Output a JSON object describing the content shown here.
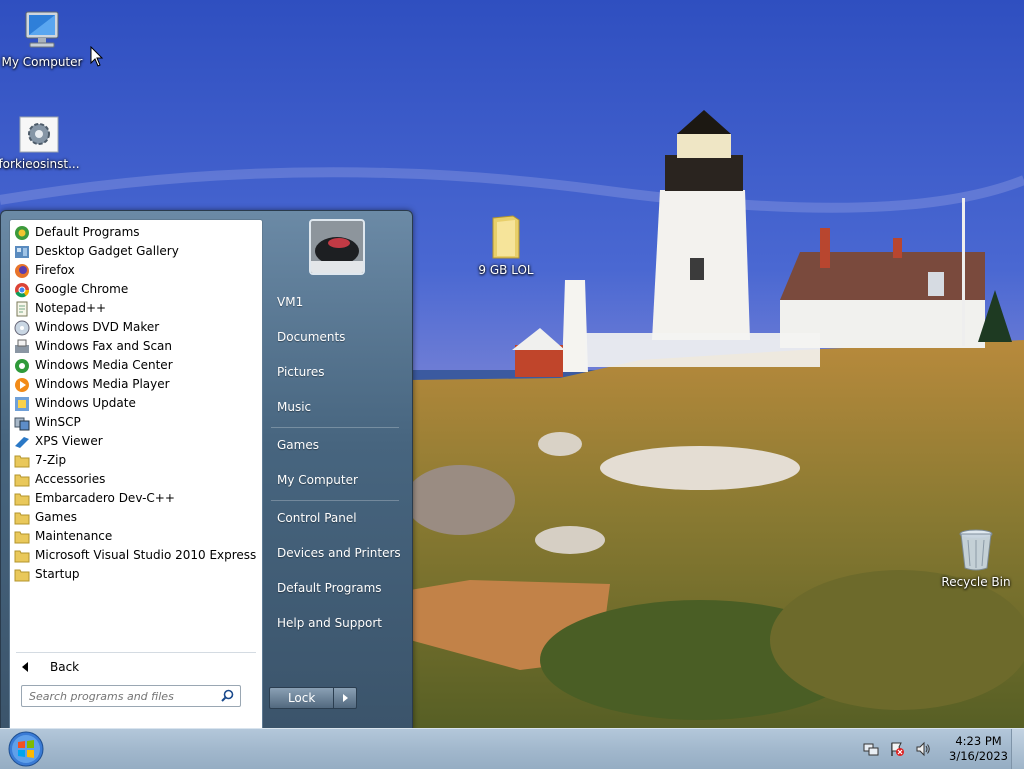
{
  "desktop": {
    "icons": [
      {
        "label": "My Computer"
      },
      {
        "label": "forkieosinst..."
      },
      {
        "label": "9 GB LOL"
      },
      {
        "label": "Recycle Bin"
      }
    ]
  },
  "start_menu": {
    "programs": [
      {
        "label": "Default Programs",
        "icon": "default-programs-icon"
      },
      {
        "label": "Desktop Gadget Gallery",
        "icon": "gadget-gallery-icon"
      },
      {
        "label": "Firefox",
        "icon": "firefox-icon"
      },
      {
        "label": "Google Chrome",
        "icon": "chrome-icon"
      },
      {
        "label": "Notepad++",
        "icon": "notepad-icon"
      },
      {
        "label": "Windows DVD Maker",
        "icon": "dvd-maker-icon"
      },
      {
        "label": "Windows Fax and Scan",
        "icon": "fax-scan-icon"
      },
      {
        "label": "Windows Media Center",
        "icon": "media-center-icon"
      },
      {
        "label": "Windows Media Player",
        "icon": "media-player-icon"
      },
      {
        "label": "Windows Update",
        "icon": "windows-update-icon"
      },
      {
        "label": "WinSCP",
        "icon": "winscp-icon"
      },
      {
        "label": "XPS Viewer",
        "icon": "xps-viewer-icon"
      },
      {
        "label": "7-Zip",
        "icon": "folder-icon"
      },
      {
        "label": "Accessories",
        "icon": "folder-icon"
      },
      {
        "label": "Embarcadero Dev-C++",
        "icon": "folder-icon"
      },
      {
        "label": "Games",
        "icon": "folder-icon"
      },
      {
        "label": "Maintenance",
        "icon": "folder-icon"
      },
      {
        "label": "Microsoft Visual Studio 2010 Express",
        "icon": "folder-icon"
      },
      {
        "label": "Startup",
        "icon": "folder-icon"
      }
    ],
    "back_label": "Back",
    "search_placeholder": "Search programs and files",
    "user_name": "VM1",
    "right_items": {
      "documents": "Documents",
      "pictures": "Pictures",
      "music": "Music",
      "games": "Games",
      "my_computer": "My Computer",
      "control_panel": "Control Panel",
      "devices_printers": "Devices and Printers",
      "default_programs": "Default Programs",
      "help_support": "Help and Support"
    },
    "lock_label": "Lock"
  },
  "taskbar": {
    "time": "4:23 PM",
    "date": "3/16/2023",
    "tray_icons": [
      "network-icon",
      "action-center-flag-icon",
      "volume-icon"
    ]
  }
}
